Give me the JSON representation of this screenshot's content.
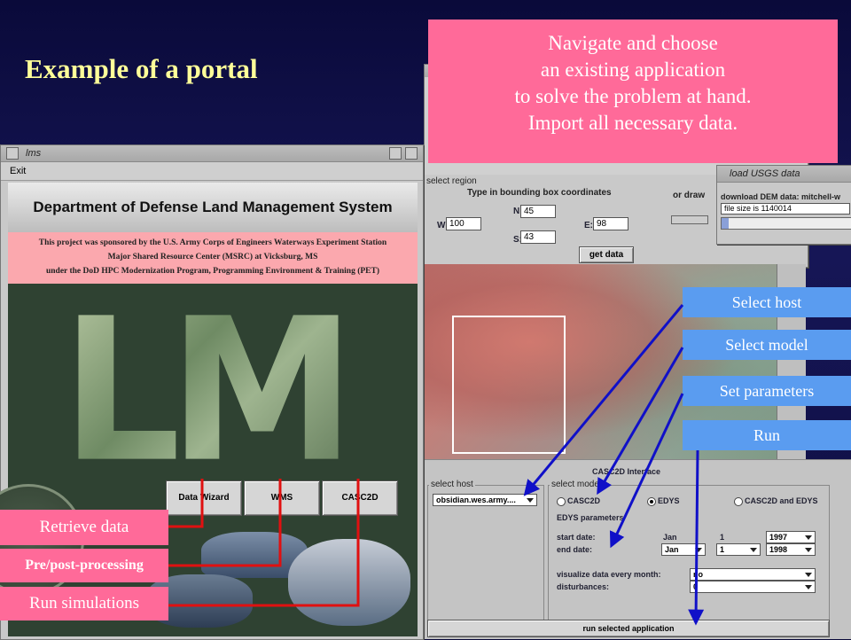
{
  "slide": {
    "title": "Example of a portal"
  },
  "callout": {
    "lines": [
      "Navigate and choose",
      "an existing application",
      "to solve the problem at hand.",
      "Import all necessary data."
    ]
  },
  "lms_window": {
    "title": "lms",
    "menu": "Exit",
    "banner": "Department of Defense Land Management System",
    "sponsor_lines": [
      "This project was sponsored by the U.S. Army Corps of Engineers Waterways Experiment Station",
      "Major Shared Resource Center (MSRC) at Vicksburg, MS",
      "under the DoD HPC Modernization Program, Programming Environment & Training (PET)"
    ],
    "logo_text": "LMS",
    "buttons": [
      "Data Wizard",
      "WMS",
      "CASC2D"
    ]
  },
  "left_labels": [
    "Retrieve data",
    "Pre/post-processing",
    "Run simulations"
  ],
  "region_window": {
    "title": "select region",
    "instruction": "Type in bounding box coordinates",
    "or_draw": "or draw",
    "n_label": "N:",
    "n_value": "45",
    "w_label": "W:",
    "w_value": "100",
    "e_label": "E:",
    "e_value": "98",
    "s_label": "S:",
    "s_value": "43",
    "get_data": "get data"
  },
  "usgs_window": {
    "title": "load USGS data",
    "download_text": "download DEM data: mitchell-w",
    "file_size": "file size is 1140014"
  },
  "right_labels": [
    "Select host",
    "Select model",
    "Set parameters",
    "Run"
  ],
  "casc_panel": {
    "title": "CASC2D Interface",
    "select_host_label": "select host",
    "host_value": "obsidian.wes.army....",
    "select_model_label": "select mode",
    "models": [
      "CASC2D",
      "EDYS",
      "CASC2D and EDYS"
    ],
    "selected_model": "EDYS",
    "params_title": "EDYS parameters",
    "start_label": "start date:",
    "start_month": "Jan",
    "start_day": "1",
    "start_year": "1997",
    "end_label": "end date:",
    "end_month": "Jan",
    "end_day": "1",
    "end_year": "1998",
    "visualize_label": "visualize data every month:",
    "visualize_value": "no",
    "disturb_label": "disturbances:",
    "disturb_value": "0",
    "run_button": "run selected application"
  },
  "colors": {
    "background": "#0d0d40",
    "callout": "#ff6a99",
    "label_blue": "#5a9cf0",
    "title": "#ffff99",
    "arrow_blue": "#1010c8",
    "line_red": "#e01010"
  }
}
